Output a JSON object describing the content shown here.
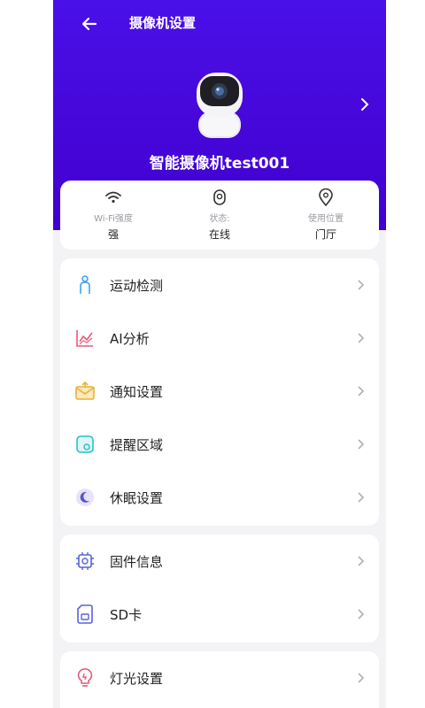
{
  "header": {
    "title": "摄像机设置",
    "device_name": "智能摄像机test001"
  },
  "status": {
    "wifi": {
      "label": "Wi-Fi强度",
      "value": "强",
      "icon": "wifi-icon"
    },
    "state": {
      "label": "状态:",
      "value": "在线",
      "icon": "status-icon"
    },
    "location": {
      "label": "使用位置",
      "value": "门厅",
      "icon": "location-pin-icon"
    }
  },
  "menu_group1": [
    {
      "label": "运动检测",
      "icon": "person-icon"
    },
    {
      "label": "AI分析",
      "icon": "chart-icon"
    },
    {
      "label": "通知设置",
      "icon": "mail-icon"
    },
    {
      "label": "提醒区域",
      "icon": "area-icon"
    },
    {
      "label": "休眠设置",
      "icon": "moon-icon"
    }
  ],
  "menu_group2": [
    {
      "label": "固件信息",
      "icon": "chip-icon"
    },
    {
      "label": "SD卡",
      "icon": "sd-card-icon"
    }
  ],
  "menu_group3": [
    {
      "label": "灯光设置",
      "icon": "bulb-icon"
    }
  ],
  "colors": {
    "header": "#4506d8",
    "background": "#f3f3f6"
  }
}
